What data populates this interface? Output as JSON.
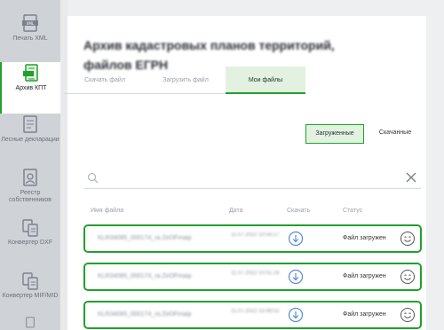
{
  "sidebar": {
    "items": [
      {
        "label": "Печать XML",
        "icon": "xml-file-icon",
        "active": false
      },
      {
        "label": "Архив КПТ",
        "icon": "archive-document-icon",
        "active": true
      },
      {
        "label": "Лесные декларации",
        "icon": "forest-declaration-icon",
        "active": false
      },
      {
        "label": "Реестр собственников",
        "icon": "owners-registry-icon",
        "active": false
      },
      {
        "label": "Конвертер DXF",
        "icon": "dxf-converter-icon",
        "active": false
      },
      {
        "label": "Конвертер MIF/MID",
        "icon": "mif-converter-icon",
        "active": false
      }
    ]
  },
  "page": {
    "title": "Архив кадастровых планов территорий, файлов ЕГРН"
  },
  "tabs": [
    {
      "label": "Скачать файл",
      "active": false
    },
    {
      "label": "Загрузить файл",
      "active": false
    },
    {
      "label": "Мои файлы",
      "active": true
    }
  ],
  "subtabs": {
    "uploaded": "Загруженные",
    "downloaded": "Скачанные"
  },
  "search": {
    "value": "",
    "placeholder": ""
  },
  "table": {
    "headers": {
      "name": "Имя файла",
      "date": "Дата",
      "download": "Скачать",
      "status": "Статус"
    },
    "rows": [
      {
        "name": "KLR34085_000174_ra.ZeOFmaip",
        "date": "11.07.2022 10:54:27",
        "status": "Файл загружен"
      },
      {
        "name": "KLR34085_000174_ra.ZeOFmaip",
        "date": "11.07.2022 10:51:16",
        "status": "Файл загружен"
      },
      {
        "name": "KLR34085_000174_ra.ZeOFmaip",
        "date": "11.07.2022 10:49:02",
        "status": "Файл загружен"
      }
    ]
  },
  "colors": {
    "accent": "#1fa12b",
    "accent_bg": "#e3f2e0",
    "sidebar_bg": "#cfd3d8"
  }
}
